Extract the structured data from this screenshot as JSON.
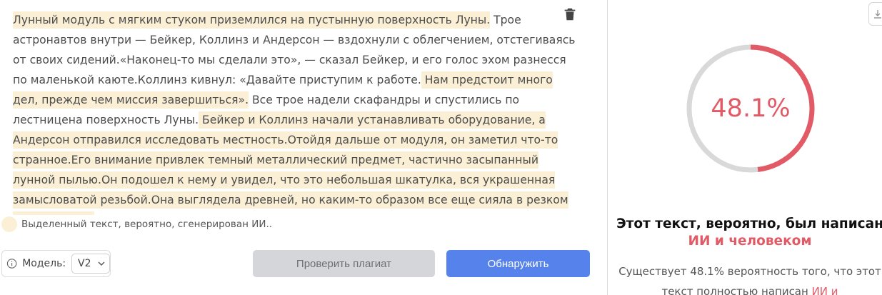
{
  "editor": {
    "segments": [
      {
        "text": "Лунный модуль с мягким стуком приземлился на пустынную поверхность Луны.",
        "highlighted": true
      },
      {
        "text": " Трое астронавтов внутри — Бейкер, Коллинз и Андерсон — вздохнули с облегчением, отстегиваясь от своих сидений.«Наконец-то мы сделали это», — сказал Бейкер, и его голос эхом разнесся по маленькой каюте.Коллинз кивнул: «Давайте приступим к работе.",
        "highlighted": false
      },
      {
        "text": " Нам предстоит много дел, прежде чем миссия завершиться».",
        "highlighted": true
      },
      {
        "text": " Все трое надели скафандры и спустились по лестницена поверхность Луны.",
        "highlighted": false
      },
      {
        "text": " Бейкер и Коллинз начали устанавливать оборудование, а Андерсон отправился исследовать местность.Отойдя дальше от модуля, он заметил что-то странное.Его внимание привлек темный металлический предмет, частично засыпанный лунной пылью.Он подошел к нему и увидел, что это небольшая шкатулка, вся украшенная замысловатой резьбой.Она выглядела древней, но каким-то образом все еще сияла в резком свете солнца.",
        "highlighted": true
      }
    ],
    "delete_icon": "trash-icon"
  },
  "legend": {
    "text": "Выделенный текст, вероятно, сгенерирован ИИ..",
    "color": "#fbf0d6"
  },
  "model": {
    "label": "Модель:",
    "selected": "V2",
    "info_icon": "info-icon"
  },
  "buttons": {
    "plagiarism": "Проверить плагиат",
    "detect": "Обнаружить"
  },
  "result": {
    "percent_text": "48.1%",
    "percent_value": 48.1,
    "verdict_prefix": "Этот текст, вероятно, был написан ",
    "verdict_highlight": "ИИ и человеком",
    "desc_prefix": "Существует 48.1% вероятность того, что этот текст полностью написан ",
    "desc_highlight": "ИИ и",
    "accent_color": "#e25a66",
    "track_color": "#d9d9d9"
  },
  "colors": {
    "primary": "#5683eb",
    "disabled": "#d5d6d9"
  }
}
